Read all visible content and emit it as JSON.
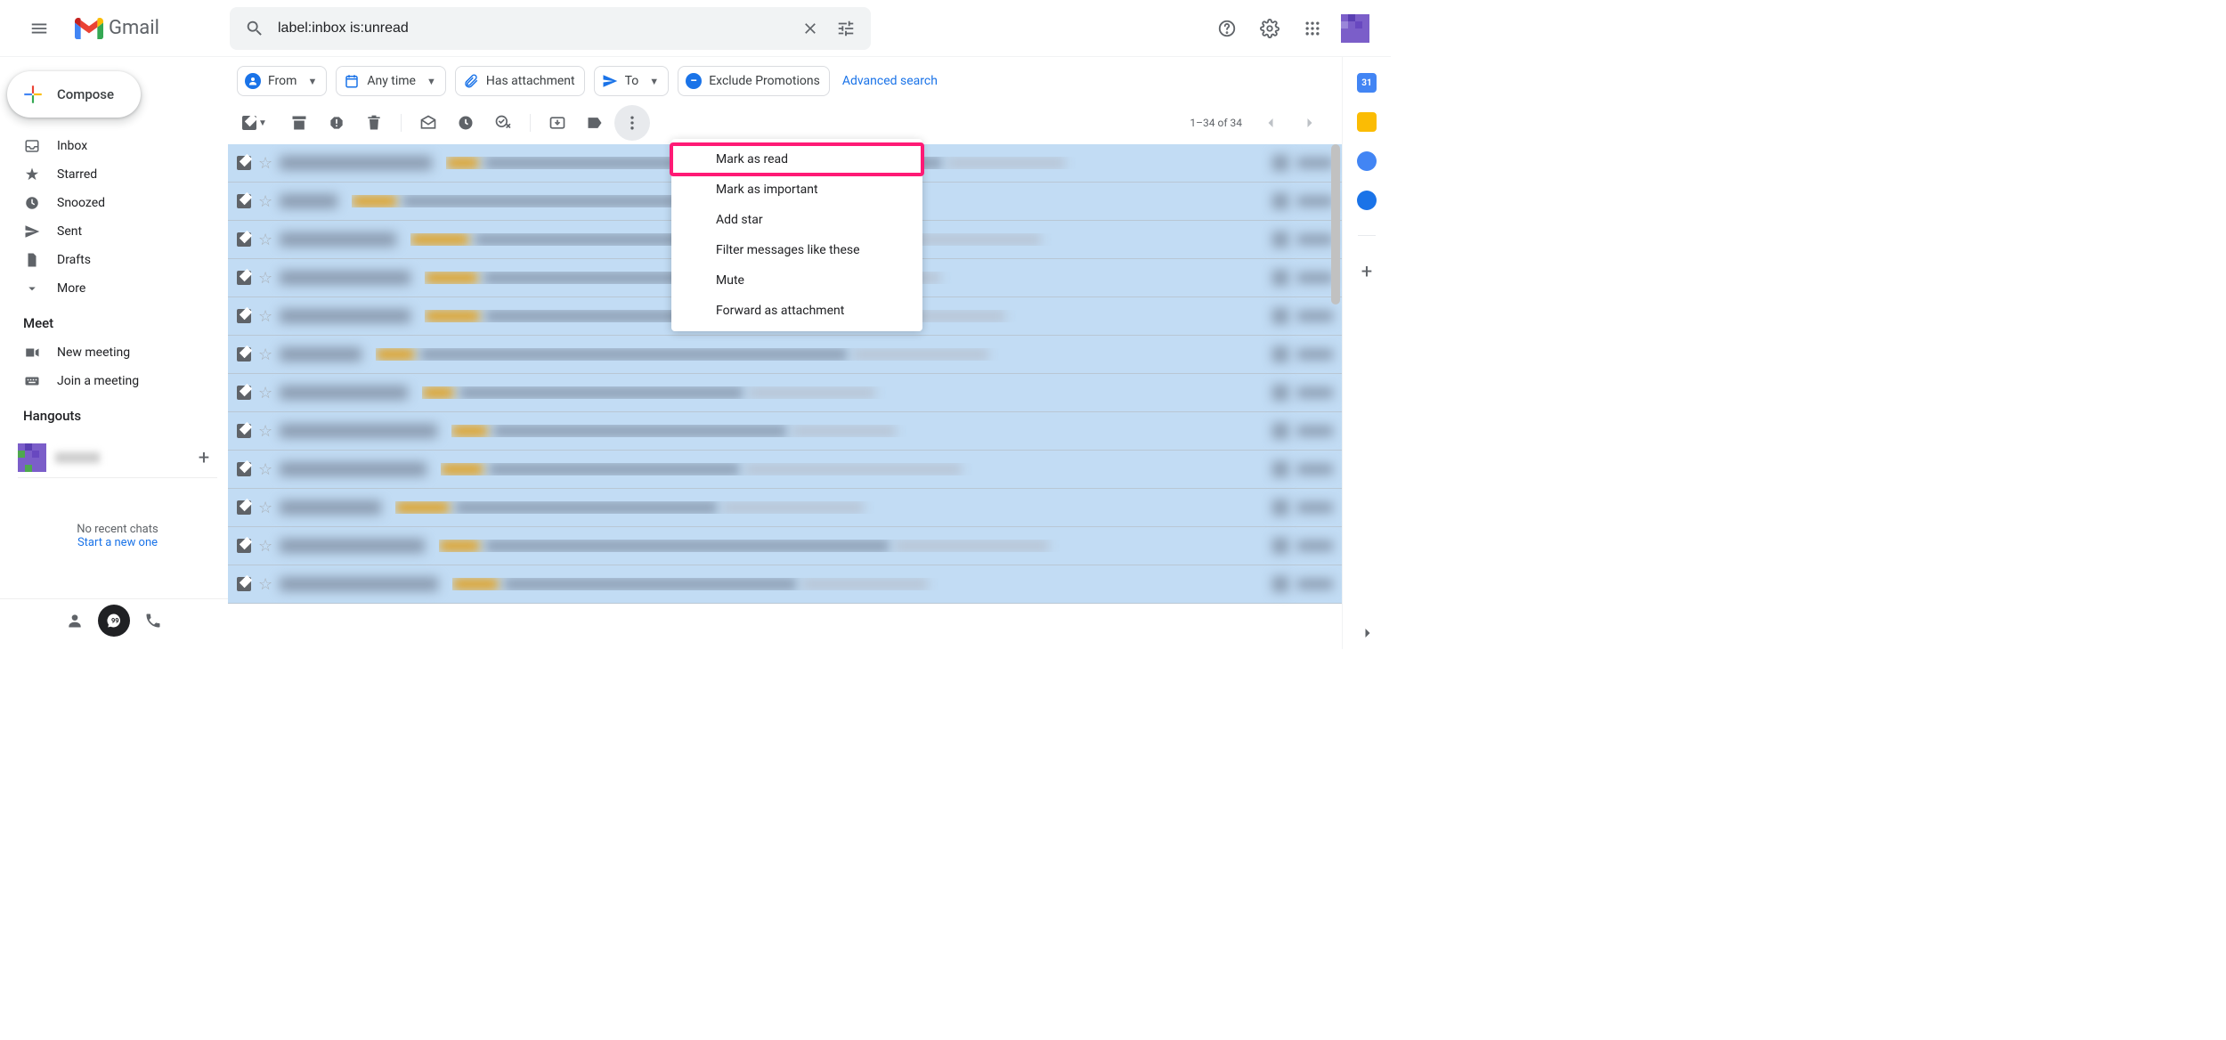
{
  "header": {
    "app_name": "Gmail",
    "search_value": "label:inbox is:unread"
  },
  "compose_label": "Compose",
  "nav": {
    "items": [
      {
        "label": "Inbox",
        "icon": "inbox"
      },
      {
        "label": "Starred",
        "icon": "star"
      },
      {
        "label": "Snoozed",
        "icon": "clock"
      },
      {
        "label": "Sent",
        "icon": "send"
      },
      {
        "label": "Drafts",
        "icon": "file"
      },
      {
        "label": "More",
        "icon": "chev"
      }
    ]
  },
  "meet": {
    "title": "Meet",
    "new_meeting": "New meeting",
    "join_meeting": "Join a meeting"
  },
  "hangouts": {
    "title": "Hangouts",
    "no_chats": "No recent chats",
    "start_new": "Start a new one"
  },
  "filters": {
    "from": "From",
    "any_time": "Any time",
    "has_attachment": "Has attachment",
    "to": "To",
    "exclude_promotions": "Exclude Promotions",
    "advanced": "Advanced search"
  },
  "pagination": {
    "range": "1–34 of 34"
  },
  "dropdown": {
    "items": [
      "Mark as read",
      "Mark as important",
      "Add star",
      "Filter messages like these",
      "Mute",
      "Forward as attachment"
    ]
  },
  "row_count": 12
}
